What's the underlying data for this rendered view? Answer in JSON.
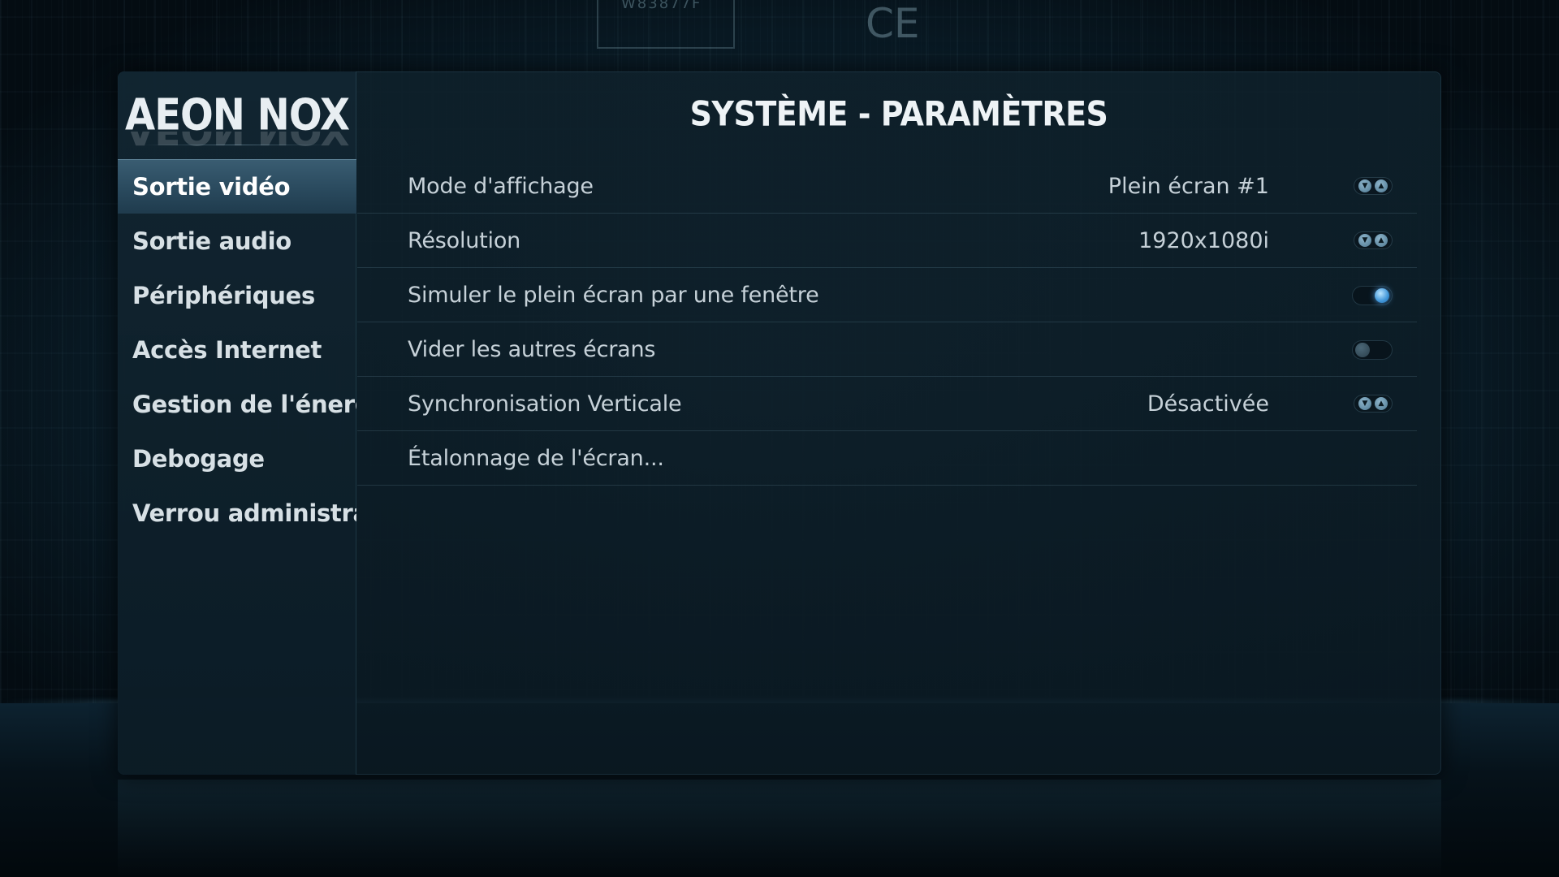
{
  "background": {
    "chip_label": "W83877F",
    "mark": "CE"
  },
  "logo": {
    "text": "AEON NOX"
  },
  "header": {
    "title": "SYSTÈME - PARAMÈTRES"
  },
  "sidebar": {
    "items": [
      {
        "label": "Sortie vidéo",
        "active": true
      },
      {
        "label": "Sortie audio",
        "active": false
      },
      {
        "label": "Périphériques",
        "active": false
      },
      {
        "label": "Accès Internet",
        "active": false
      },
      {
        "label": "Gestion de l'énergie",
        "active": false
      },
      {
        "label": "Debogage",
        "active": false
      },
      {
        "label": "Verrou administra...",
        "active": false
      }
    ]
  },
  "settings": {
    "rows": [
      {
        "label": "Mode d'affichage",
        "value": "Plein écran #1",
        "control": "spinner"
      },
      {
        "label": "Résolution",
        "value": "1920x1080i",
        "control": "spinner"
      },
      {
        "label": "Simuler le plein écran par une fenêtre",
        "control": "toggle",
        "state": "on"
      },
      {
        "label": "Vider les autres écrans",
        "control": "toggle",
        "state": "off"
      },
      {
        "label": "Synchronisation Verticale",
        "value": "Désactivée",
        "control": "spinner"
      },
      {
        "label": "Étalonnage de l'écran...",
        "control": "none"
      }
    ]
  },
  "colors": {
    "accent": "#3f95d8",
    "active_item": "#2a4a5e",
    "text": "#c6d1d8"
  },
  "icons": {
    "spinner_down": "chevron-down-icon",
    "spinner_up": "chevron-up-icon"
  }
}
